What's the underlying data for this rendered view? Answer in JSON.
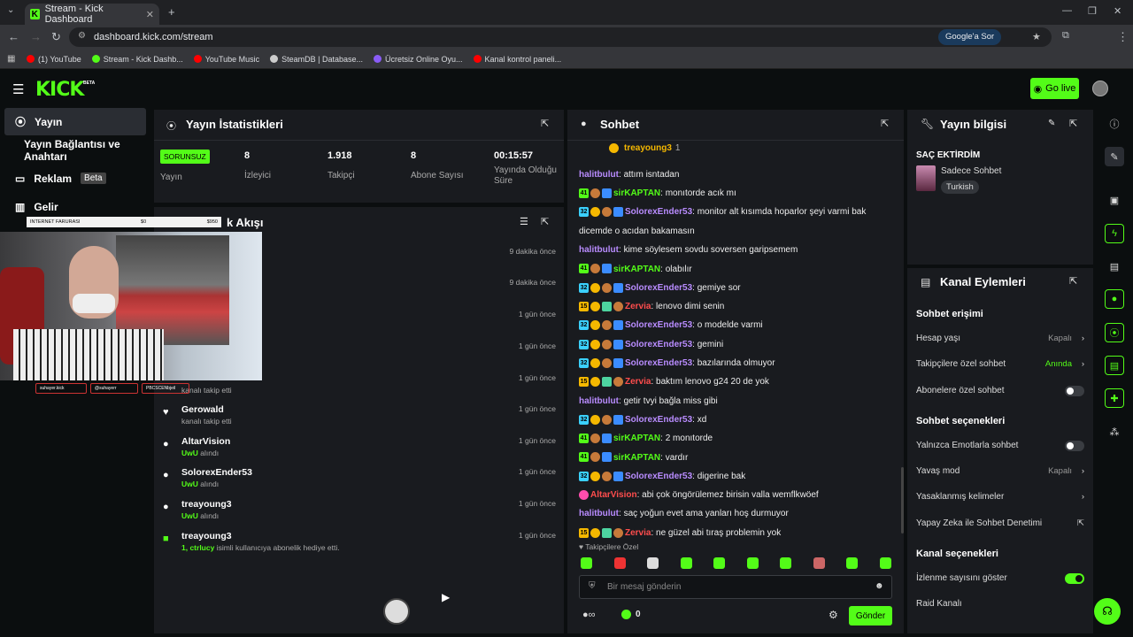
{
  "browser": {
    "tab_title": "Stream - Kick Dashboard",
    "url": "dashboard.kick.com/stream",
    "google_label": "Google'a Sor",
    "bookmarks": [
      {
        "label": "(1) YouTube",
        "color": "#ff0000"
      },
      {
        "label": "Stream - Kick Dashb...",
        "color": "#53fc18"
      },
      {
        "label": "YouTube Music",
        "color": "#ff0000"
      },
      {
        "label": "SteamDB | Database...",
        "color": "#cccccc"
      },
      {
        "label": "Ücretsiz Online Oyu...",
        "color": "#8a5cf6"
      },
      {
        "label": "Kanal kontrol paneli...",
        "color": "#ff0000"
      }
    ]
  },
  "header": {
    "logo": "KICK",
    "beta": "BETA",
    "go_live": "Go live"
  },
  "sidebar": {
    "items": [
      {
        "label": "Yayın"
      },
      {
        "label": "Yayın Bağlantısı ve Anahtarı"
      },
      {
        "label": "Reklam",
        "badge": "Beta"
      },
      {
        "label": "Gelir"
      }
    ]
  },
  "webcam": {
    "overlay_left": "INTERNET FARURASI",
    "overlay_mid": "$0",
    "overlay_right": "$950",
    "socials": [
      "suhayer.kick",
      "@suhayerr",
      "PBCSCENbjeil"
    ]
  },
  "stats": {
    "title": "Yayın İstatistikleri",
    "status": "SORUNSUZ",
    "status_label": "Yayın",
    "items": [
      {
        "value": "8",
        "label": "İzleyici"
      },
      {
        "value": "1.918",
        "label": "Takipçi"
      },
      {
        "value": "8",
        "label": "Abone Sayısı"
      },
      {
        "value": "00:15:57",
        "label": "Yayında Olduğu Süre"
      }
    ]
  },
  "feed": {
    "title": "k Akışı",
    "rows": [
      {
        "time": "9 dakika önce"
      },
      {
        "time": "9 dakika önce"
      },
      {
        "time": "1 gün önce"
      },
      {
        "time": "1 gün önce"
      },
      {
        "name": "",
        "sub": "kanalı takip etti",
        "time": "1 gün önce"
      },
      {
        "name": "Gerowald",
        "sub": "kanalı takip etti",
        "time": "1 gün önce",
        "icon": "♥"
      },
      {
        "name": "AltarVision",
        "sub_green": "UwU",
        "sub": "alındı",
        "time": "1 gün önce",
        "icon": "●"
      },
      {
        "name": "SolorexEnder53",
        "sub_green": "UwU",
        "sub": "alındı",
        "time": "1 gün önce",
        "icon": "●"
      },
      {
        "name": "treayoung3",
        "sub_green": "UwU",
        "sub": "alındı",
        "time": "1 gün önce",
        "icon": "●"
      },
      {
        "name": "treayoung3",
        "sub_green": "1, ctrlucy",
        "sub": "isimli kullanıcıya abonelik hediye etti.",
        "time": "1 gün önce",
        "icon": "■"
      }
    ]
  },
  "chat": {
    "title": "Sohbet",
    "pinned_user": "treayoung3",
    "pinned_count": "1",
    "messages": [
      {
        "badges": [],
        "user": "halitbulut",
        "color": "#b98cff",
        "text": "attım isntadan"
      },
      {
        "badges": [
          "41",
          "cook",
          "blue"
        ],
        "user": "sirKAPTAN",
        "color": "#53fc18",
        "text": "monıtorde acık mı"
      },
      {
        "badges": [
          "32",
          "gold",
          "cook",
          "blue"
        ],
        "user": "SolorexEnder53",
        "color": "#b98cff",
        "text": "monitor alt kısımda hoparlor şeyi varmi bak"
      },
      {
        "badges": [],
        "user": "",
        "color": "#eee",
        "text": "dicemde o acıdan bakamasın"
      },
      {
        "badges": [],
        "user": "halitbulut",
        "color": "#b98cff",
        "text": "kime söylesem sovdu soversen garipsemem"
      },
      {
        "badges": [
          "41",
          "cook",
          "blue"
        ],
        "user": "sirKAPTAN",
        "color": "#53fc18",
        "text": "olabılır"
      },
      {
        "badges": [
          "32",
          "gold",
          "cook",
          "blue"
        ],
        "user": "SolorexEnder53",
        "color": "#b98cff",
        "text": "gemiye sor"
      },
      {
        "badges": [
          "15",
          "gold",
          "gift",
          "cook"
        ],
        "user": "Zervia",
        "color": "#ff4d4d",
        "text": "lenovo dimi senin"
      },
      {
        "badges": [
          "32",
          "gold",
          "cook",
          "blue"
        ],
        "user": "SolorexEnder53",
        "color": "#b98cff",
        "text": "o modelde varmi"
      },
      {
        "badges": [
          "32",
          "gold",
          "cook",
          "blue"
        ],
        "user": "SolorexEnder53",
        "color": "#b98cff",
        "text": "gemini"
      },
      {
        "badges": [
          "32",
          "gold",
          "cook",
          "blue"
        ],
        "user": "SolorexEnder53",
        "color": "#b98cff",
        "text": "bazılarında olmuyor"
      },
      {
        "badges": [
          "15",
          "gold",
          "gift",
          "cook"
        ],
        "user": "Zervia",
        "color": "#ff4d4d",
        "text": "baktım lenovo g24 20 de yok"
      },
      {
        "badges": [],
        "user": "halitbulut",
        "color": "#b98cff",
        "text": "getir tvyi bağla miss gibi"
      },
      {
        "badges": [
          "32",
          "gold",
          "cook",
          "blue"
        ],
        "user": "SolorexEnder53",
        "color": "#b98cff",
        "text": "xd"
      },
      {
        "badges": [
          "41",
          "cook",
          "blue"
        ],
        "user": "sirKAPTAN",
        "color": "#53fc18",
        "text": "2 monıtorde"
      },
      {
        "badges": [
          "41",
          "cook",
          "blue"
        ],
        "user": "sirKAPTAN",
        "color": "#53fc18",
        "text": "vardır"
      },
      {
        "badges": [
          "32",
          "gold",
          "cook",
          "blue"
        ],
        "user": "SolorexEnder53",
        "color": "#b98cff",
        "text": "digerine bak"
      },
      {
        "badges": [
          "pink"
        ],
        "user": "AltarVision",
        "color": "#ff4d4d",
        "text": "abi çok öngörülemez birisin valla wemflkwöef"
      },
      {
        "badges": [],
        "user": "halitbulut",
        "color": "#b98cff",
        "text": "saç yoğun evet ama yanları hoş durmuyor"
      },
      {
        "badges": [
          "15",
          "gold",
          "gift",
          "cook"
        ],
        "user": "Zervia",
        "color": "#ff4d4d",
        "text": "ne güzel abi tıraş problemin yok"
      }
    ],
    "followers_only": "Takipçilere Özel",
    "input_placeholder": "Bir mesaj gönderin",
    "count": "0",
    "send": "Gönder"
  },
  "info": {
    "title": "Yayın bilgisi",
    "stream_title": "SAÇ EKTİRDİM",
    "category": "Sadece Sohbet",
    "language": "Turkish"
  },
  "actions": {
    "title": "Kanal Eylemleri",
    "chat_access": "Sohbet erişimi",
    "account_age": {
      "label": "Hesap yaşı",
      "value": "Kapalı"
    },
    "followers_chat": {
      "label": "Takipçilere özel sohbet",
      "value": "Anında"
    },
    "subs_chat": {
      "label": "Abonelere özel sohbet"
    },
    "chat_options": "Sohbet seçenekleri",
    "emote_only": {
      "label": "Yalnızca Emotlarla sohbet"
    },
    "slow_mode": {
      "label": "Yavaş mod",
      "value": "Kapalı"
    },
    "banned_words": {
      "label": "Yasaklanmış kelimeler"
    },
    "ai_mod": {
      "label": "Yapay Zeka ile Sohbet Denetimi"
    },
    "channel_options": "Kanal seçenekleri",
    "show_viewers": {
      "label": "İzlenme sayısını göster"
    },
    "raid": {
      "label": "Raid Kanalı"
    }
  },
  "colors": {
    "accent": "#53fc18",
    "panel": "#191b1f",
    "bg": "#0b0e0f"
  }
}
